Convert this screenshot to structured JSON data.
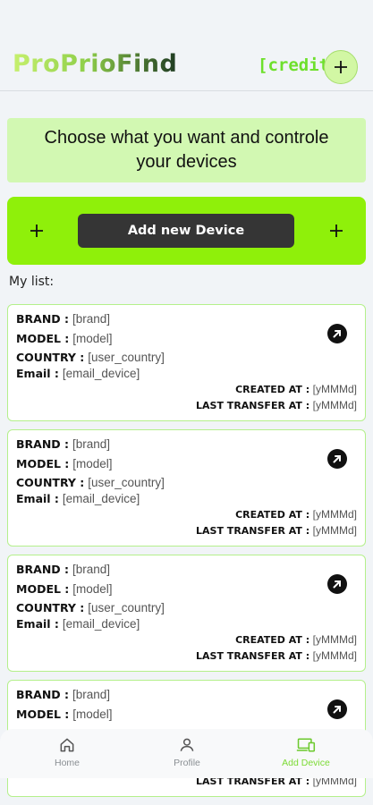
{
  "header": {
    "logo": "ProPrioFind",
    "credit": "[credit]",
    "add_icon": "plus-icon"
  },
  "banner": {
    "text": "Choose what you want and controle your devices"
  },
  "add_device": {
    "button_label": "Add new Device",
    "left_icon": "plus-icon",
    "right_icon": "plus-icon"
  },
  "list_label": "My list:",
  "devices": [
    {
      "brand_key": "BRAND :",
      "brand": "[brand]",
      "model_key": "MODEL :",
      "model": "[model]",
      "country_key": "COUNTRY :",
      "country": "[user_country]",
      "email_key": "Email :",
      "email": "[email_device]",
      "created_key": "CREATED AT :",
      "created": "[yMMMd]",
      "transfer_key": "LAST TRANSFER AT :",
      "transfer": "[yMMMd]"
    },
    {
      "brand_key": "BRAND :",
      "brand": "[brand]",
      "model_key": "MODEL :",
      "model": "[model]",
      "country_key": "COUNTRY :",
      "country": "[user_country]",
      "email_key": "Email :",
      "email": "[email_device]",
      "created_key": "CREATED AT :",
      "created": "[yMMMd]",
      "transfer_key": "LAST TRANSFER AT :",
      "transfer": "[yMMMd]"
    },
    {
      "brand_key": "BRAND :",
      "brand": "[brand]",
      "model_key": "MODEL :",
      "model": "[model]",
      "country_key": "COUNTRY :",
      "country": "[user_country]",
      "email_key": "Email :",
      "email": "[email_device]",
      "created_key": "CREATED AT :",
      "created": "[yMMMd]",
      "transfer_key": "LAST TRANSFER AT :",
      "transfer": "[yMMMd]"
    },
    {
      "brand_key": "BRAND :",
      "brand": "[brand]",
      "model_key": "MODEL :",
      "model": "[model]",
      "transfer_key": "LAST TRANSFER AT :",
      "transfer": "[yMMMd]"
    }
  ],
  "nav": {
    "items": [
      {
        "label": "Home",
        "icon": "home-icon"
      },
      {
        "label": "Profile",
        "icon": "person-icon"
      },
      {
        "label": "Add Device",
        "icon": "devices-icon"
      }
    ],
    "active_color": "#7cdb34"
  },
  "colors": {
    "accent_green": "#8ff00a",
    "banner_bg": "#d2f8b2",
    "card_border": "#b4f08b",
    "button_dark": "#353535"
  }
}
